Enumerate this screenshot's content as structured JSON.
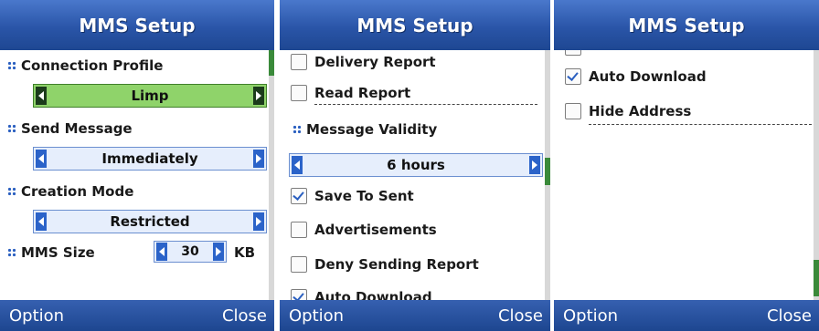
{
  "screens": [
    {
      "title": "MMS Setup",
      "connection_profile": {
        "label": "Connection Profile",
        "value": "Limp"
      },
      "send_message": {
        "label": "Send Message",
        "value": "Immediately"
      },
      "creation_mode": {
        "label": "Creation Mode",
        "value": "Restricted"
      },
      "mms_size": {
        "label": "MMS Size",
        "value": "30",
        "unit": "KB"
      },
      "softkeys": {
        "left": "Option",
        "right": "Close"
      }
    },
    {
      "title": "MMS Setup",
      "items": {
        "delivery_report": {
          "label": "Delivery Report",
          "checked": false
        },
        "read_report": {
          "label": "Read Report",
          "checked": false
        },
        "message_validity": {
          "label": "Message Validity",
          "value": "6 hours"
        },
        "save_to_sent": {
          "label": "Save To Sent",
          "checked": true
        },
        "advertisements": {
          "label": "Advertisements",
          "checked": false
        },
        "deny_sending_report": {
          "label": "Deny Sending Report",
          "checked": false
        },
        "auto_download": {
          "label": "Auto Download",
          "checked": true
        }
      },
      "softkeys": {
        "left": "Option",
        "right": "Close"
      }
    },
    {
      "title": "MMS Setup",
      "items": {
        "auto_download": {
          "label": "Auto Download",
          "checked": true
        },
        "hide_address": {
          "label": "Hide Address",
          "checked": false
        }
      },
      "softkeys": {
        "left": "Option",
        "right": "Close"
      }
    }
  ],
  "colors": {
    "titlebar": "#2a55a8",
    "selected_field": "#8fd36a",
    "arrow": "#2b63c9"
  }
}
